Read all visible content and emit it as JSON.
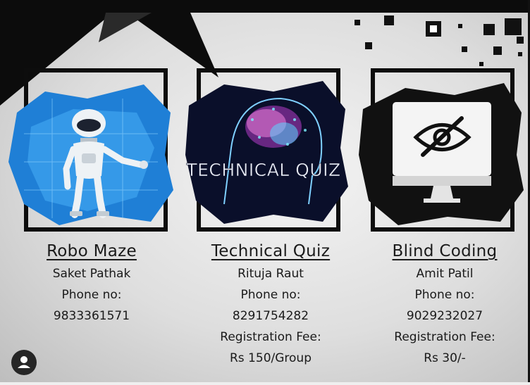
{
  "events": [
    {
      "title": "Robo Maze",
      "coordinator": "Saket Pathak",
      "phone_label": "Phone no:",
      "phone": "9833361571",
      "fee_label": "",
      "fee": "",
      "image_icon": "robot-icon"
    },
    {
      "title": "Technical Quiz",
      "coordinator": "Rituja Raut",
      "phone_label": "Phone no:",
      "phone": "8291754282",
      "fee_label": "Registration Fee:",
      "fee": "Rs 150/Group",
      "image_icon": "brain-icon",
      "image_text": "TECHNICAL QUIZ"
    },
    {
      "title": "Blind Coding",
      "coordinator": "Amit Patil",
      "phone_label": "Phone no:",
      "phone": "9029232027",
      "fee_label": "Registration Fee:",
      "fee": "Rs 30/-",
      "image_icon": "eye-slash-icon"
    }
  ],
  "colors": {
    "frame": "#0d0d0d",
    "text": "#1a1a1a",
    "robot_bg": "#1f7fd6",
    "quiz_bg": "#0b1a4a"
  },
  "profile_icon": "person-icon"
}
